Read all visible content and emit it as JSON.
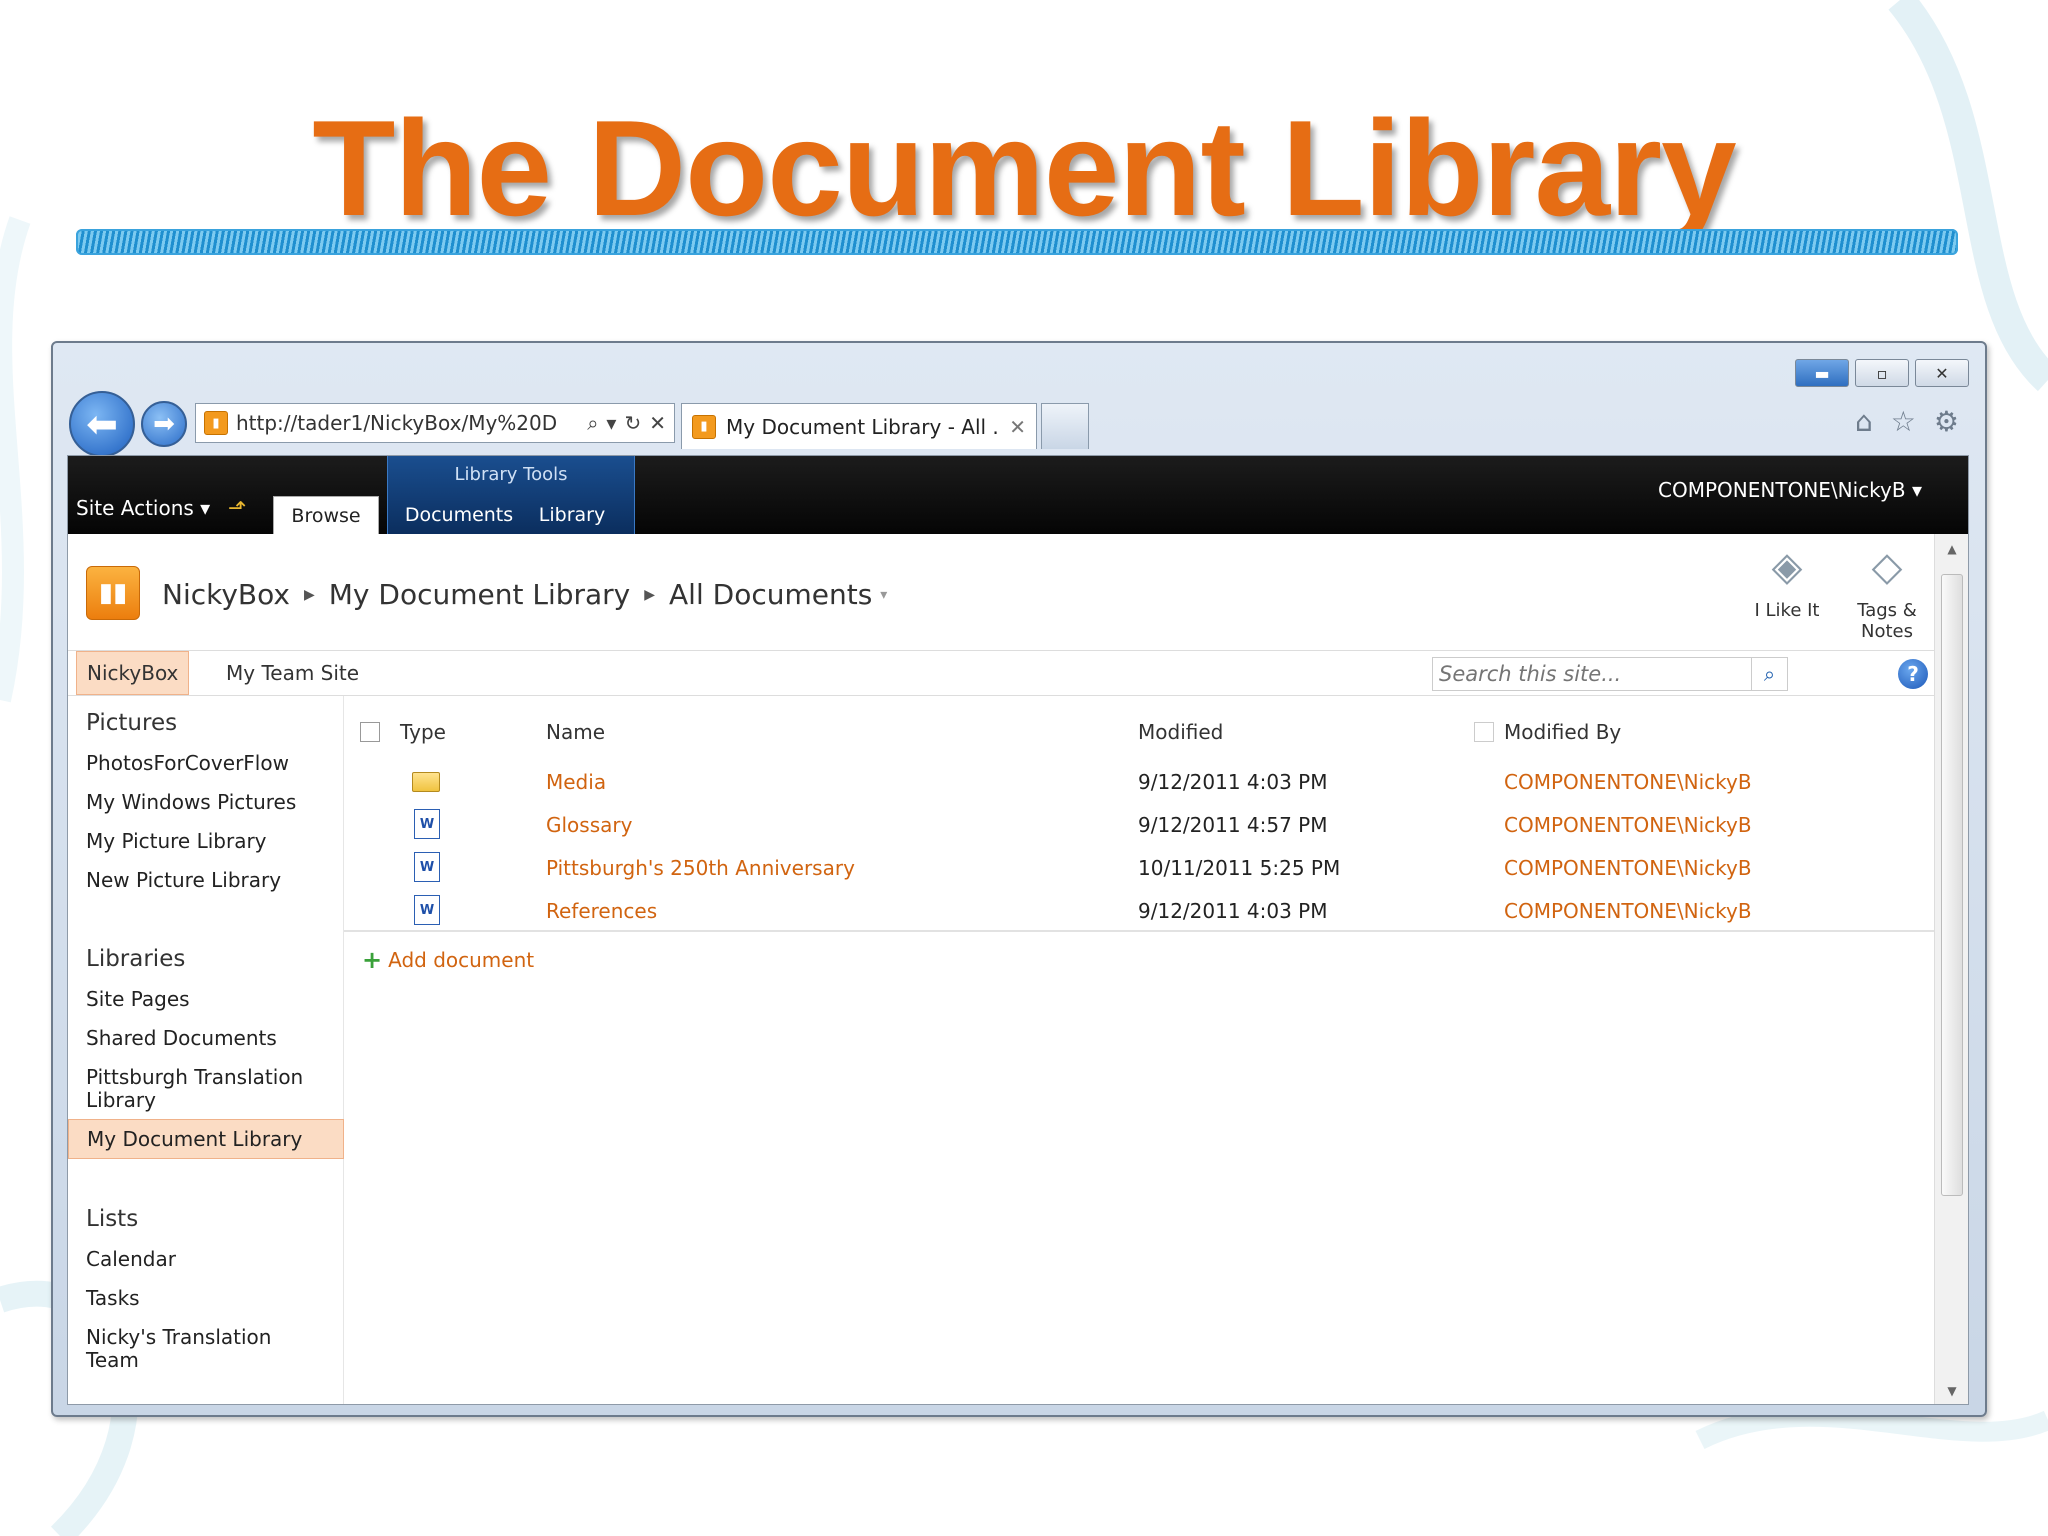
{
  "slide": {
    "title": "The Document Library"
  },
  "browser": {
    "address_url": "http://tader1/NickyBox/My%20D",
    "tab_title": "My Document Library - All ...",
    "window_controls": [
      "minimize-icon",
      "restore-icon",
      "close-icon"
    ],
    "toolbar_icons": [
      "home-icon",
      "star-icon",
      "gear-icon"
    ]
  },
  "ribbon": {
    "site_actions": "Site Actions ▾",
    "browse_tab": "Browse",
    "context_group": "Library Tools",
    "documents_tab": "Documents",
    "library_tab": "Library",
    "user": "COMPONENTONE\\NickyB ▾"
  },
  "breadcrumb": {
    "site": "NickyBox",
    "library": "My Document Library",
    "view": "All Documents"
  },
  "social": {
    "like": "I Like It",
    "tags_line1": "Tags &",
    "tags_line2": "Notes"
  },
  "topnav": {
    "items": [
      "NickyBox",
      "My Team Site"
    ],
    "search_placeholder": "Search this site..."
  },
  "leftnav": {
    "pictures_heading": "Pictures",
    "pictures": [
      "PhotosForCoverFlow",
      "My Windows Pictures",
      "My Picture Library",
      "New Picture Library"
    ],
    "libraries_heading": "Libraries",
    "libraries": [
      "Site Pages",
      "Shared Documents",
      "Pittsburgh Translation Library",
      "My Document Library"
    ],
    "lists_heading": "Lists",
    "lists": [
      "Calendar",
      "Tasks",
      "Nicky's Translation Team"
    ]
  },
  "list": {
    "columns": [
      "Type",
      "Name",
      "Modified",
      "Modified By"
    ],
    "rows": [
      {
        "type": "folder",
        "name": "Media",
        "modified": "9/12/2011 4:03 PM",
        "modified_by": "COMPONENTONE\\NickyB"
      },
      {
        "type": "word",
        "name": "Glossary",
        "modified": "9/12/2011 4:57 PM",
        "modified_by": "COMPONENTONE\\NickyB"
      },
      {
        "type": "word",
        "name": "Pittsburgh's 250th Anniversary",
        "modified": "10/11/2011 5:25 PM",
        "modified_by": "COMPONENTONE\\NickyB"
      },
      {
        "type": "word",
        "name": "References",
        "modified": "9/12/2011 4:03 PM",
        "modified_by": "COMPONENTONE\\NickyB"
      }
    ],
    "add_document": "Add document"
  },
  "colors": {
    "accent_orange": "#e66d14",
    "link_orange": "#d16410",
    "ribbon_black": "#050505",
    "highlight": "#fbdcc4"
  }
}
